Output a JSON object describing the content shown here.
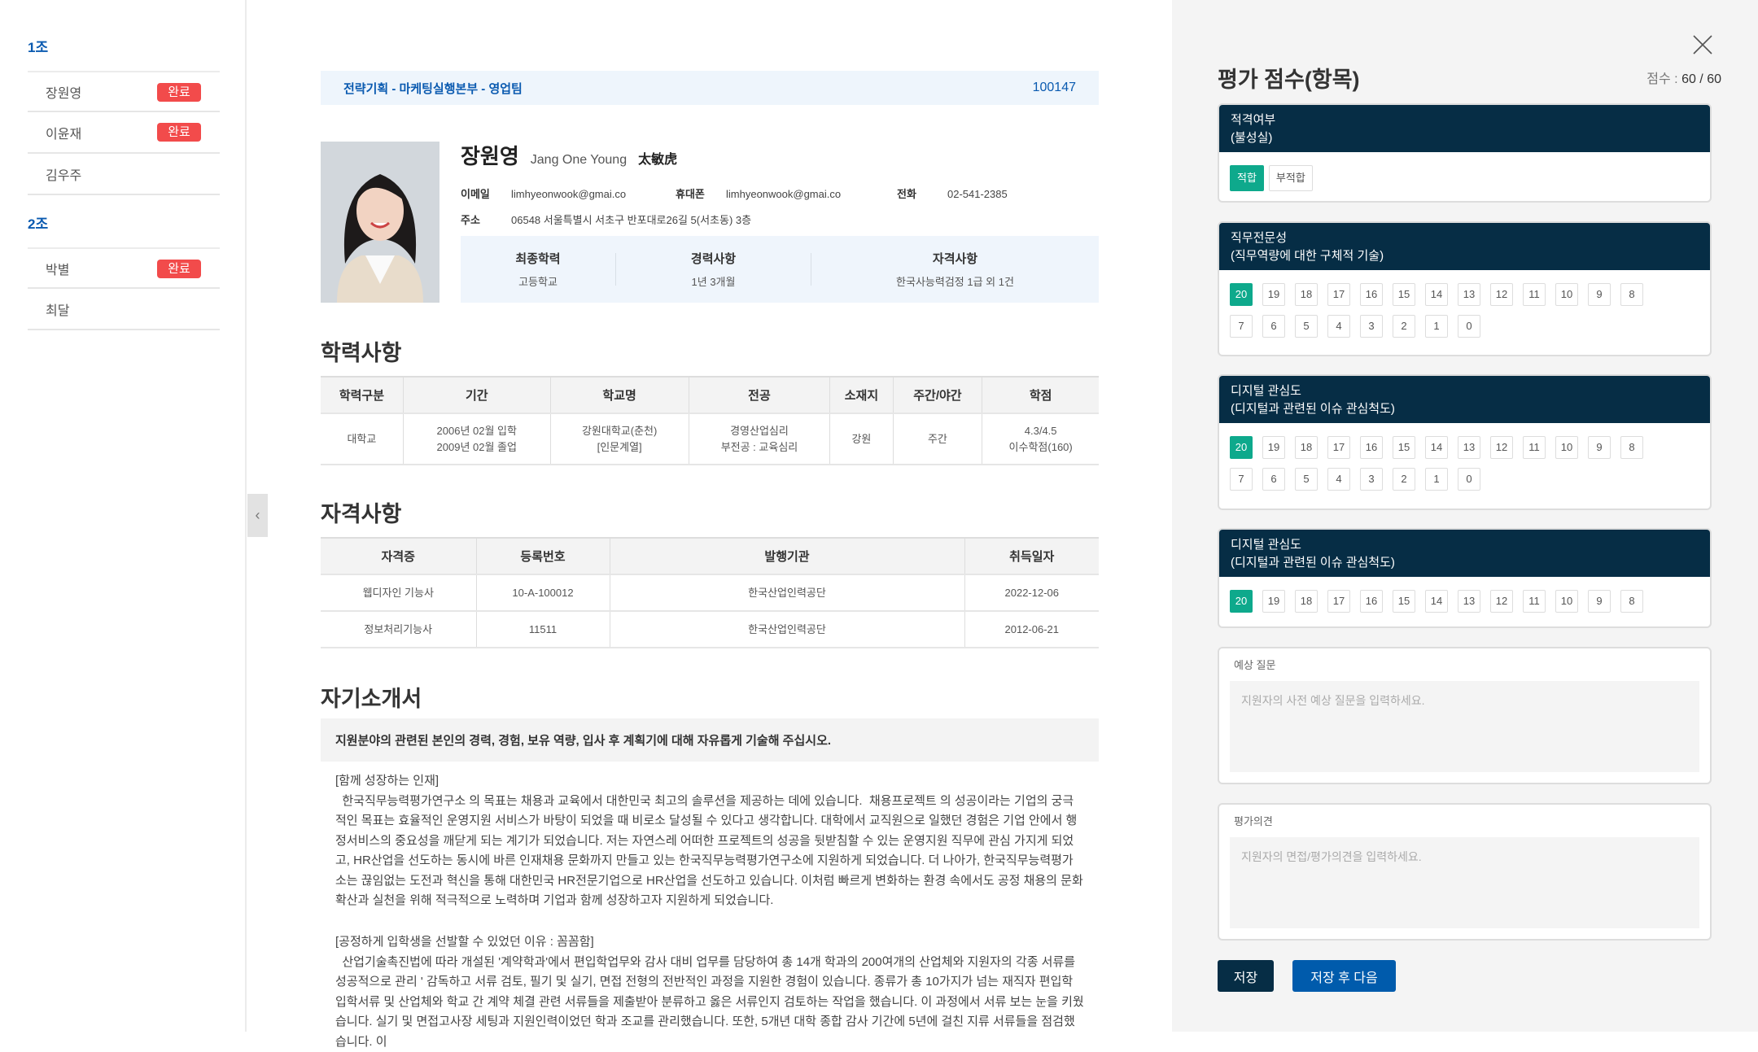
{
  "sidebar": {
    "groups": [
      {
        "label": "1조",
        "members": [
          {
            "name": "장원영",
            "badge": "완료"
          },
          {
            "name": "이윤재",
            "badge": "완료"
          },
          {
            "name": "김우주"
          }
        ]
      },
      {
        "label": "2조",
        "members": [
          {
            "name": "박별",
            "badge": "완료"
          },
          {
            "name": "최달"
          }
        ]
      }
    ]
  },
  "header": {
    "department": "전략기획 - 마케팅실행본부 - 영업팀",
    "applicant_id": "100147"
  },
  "profile": {
    "name_ko": "장원영",
    "name_en": "Jang One Young",
    "name_hanja": "太敏虎",
    "email_label": "이메일",
    "email": "limhyeonwook@gmai.co",
    "mobile_label": "휴대폰",
    "mobile": "limhyeonwook@gmai.co",
    "phone_label": "전화",
    "phone": "02-541-2385",
    "address_label": "주소",
    "address": "06548 서울특별시 서초구 반포대로26길 5(서초동) 3층",
    "summary": [
      {
        "title": "최종학력",
        "value": "고등학교"
      },
      {
        "title": "경력사항",
        "value": "1년 3개월"
      },
      {
        "title": "자격사항",
        "value": "한국사능력검정 1급 외 1건"
      }
    ]
  },
  "education": {
    "title": "학력사항",
    "headers": [
      "학력구분",
      "기간",
      "학교명",
      "전공",
      "소재지",
      "주간/야간",
      "학점"
    ],
    "rows": [
      [
        "대학교",
        "2006년 02월 입학\n2009년 02월 졸업",
        "강원대학교(춘천)\n[인문계열]",
        "경영산업심리\n부전공 : 교육심리",
        "강원",
        "주간",
        "4.3/4.5\n이수학점(160)"
      ]
    ]
  },
  "certificates": {
    "title": "자격사항",
    "headers": [
      "자격증",
      "등록번호",
      "발행기관",
      "취득일자"
    ],
    "rows": [
      [
        "웹디자인 기능사",
        "10-A-100012",
        "한국산업인력공단",
        "2022-12-06"
      ],
      [
        "정보처리기능사",
        "11511",
        "한국산업인력공단",
        "2012-06-21"
      ]
    ]
  },
  "essay": {
    "title": "자기소개서",
    "question": "지원분야의 관련된 본인의 경력, 경험, 보유 역량, 입사 후 계획기에 대해 자유롭게 기술해 주십시오.",
    "p1_title": "[함께 성장하는 인재]",
    "p1_body": "  한국직무능력평가연구소 의 목표는 채용과 교육에서 대한민국 최고의 솔루션을 제공하는 데에 있습니다.  채용프로젝트 의 성공이라는 기업의 궁극적인 목표는 효율적인 운영지원 서비스가 바탕이 되었을 때 비로소 달성될 수 있다고 생각합니다. 대학에서 교직원으로 일했던 경험은 기업 안에서 행정서비스의 중요성을 깨닫게 되는 계기가 되었습니다. 저는 자연스레 어떠한 프로젝트의 성공을 뒷받침할 수 있는 운영지원 직무에 관심 가지게 되었고, HR산업을 선도하는 동시에 바른 인재채용 문화까지 만들고 있는 한국직무능력평가연구소에 지원하게 되었습니다. 더 나아가, 한국직무능력평가소는 끊임없는 도전과 혁신을 통해 대한민국 HR전문기업으로 HR산업을 선도하고 있습니다. 이처럼 빠르게 변화하는 환경 속에서도 공정 채용의 문화확산과 실천을 위해 적극적으로 노력하며 기업과 함께 성장하고자 지원하게 되었습니다.",
    "p2_title": "[공정하게 입학생을 선발할 수 있었던 이유 : 꼼꼼함]",
    "p2_body": "  산업기술촉진법에 따라 개설된 '계약학과'에서 편입학업무와 감사 대비 업무를 담당하여 총 14개 학과의 200여개의 산업체와 지원자의 각종 서류를 성공적으로 관리 ' 감독하고 서류 검토, 필기 및 실기, 면접 전형의 전반적인 과정을 지원한 경험이 있습니다. 종류가 총 10가지가 넘는 재직자 편입학 입학서류 및 산업체와 학교 간 계약 체결 관련 서류들을 제출받아 분류하고 옳은 서류인지 검토하는 작업을 했습니다. 이 과정에서 서류 보는 눈을 키웠습니다. 실기 및 면접고사장 세팅과 지원인력이었던 학과 조교를 관리했습니다. 또한, 5개년 대학 종합 감사 기간에 5년에 걸친 지류 서류들을 점검했습니다. 이"
  },
  "panel": {
    "title": "평가 점수(항목)",
    "score_label": "점수 : ",
    "score": "60 / 60",
    "eligibility": {
      "title": "적격여부",
      "subtitle": "(불성실)",
      "options": [
        "적합",
        "부적합"
      ],
      "selected": "적합"
    },
    "criteria": [
      {
        "title": "직무전문성",
        "subtitle": "(직무역량에 대한 구체적 기술)",
        "options": [
          "20",
          "19",
          "18",
          "17",
          "16",
          "15",
          "14",
          "13",
          "12",
          "11",
          "10",
          "9",
          "8",
          "7",
          "6",
          "5",
          "4",
          "3",
          "2",
          "1",
          "0"
        ],
        "selected": "20"
      },
      {
        "title": "디지털 관심도",
        "subtitle": "(디지털과 관련된 이슈 관심척도)",
        "options": [
          "20",
          "19",
          "18",
          "17",
          "16",
          "15",
          "14",
          "13",
          "12",
          "11",
          "10",
          "9",
          "8",
          "7",
          "6",
          "5",
          "4",
          "3",
          "2",
          "1",
          "0"
        ],
        "selected": "20"
      },
      {
        "title": "디지털 관심도",
        "subtitle": "(디지털과 관련된 이슈 관심척도)",
        "options": [
          "20",
          "19",
          "18",
          "17",
          "16",
          "15",
          "14",
          "13",
          "12",
          "11",
          "10",
          "9",
          "8"
        ],
        "selected": "20"
      }
    ],
    "questions": {
      "label": "예상 질문",
      "placeholder": "지원자의 사전 예상 질문을 입력하세요."
    },
    "opinion": {
      "label": "평가의견",
      "placeholder": "지원자의 면접/평가의견을 입력하세요."
    },
    "save_label": "저장",
    "save_next_label": "저장 후 다음",
    "colors": {
      "navy": "#062d45",
      "selected": "#0ea98c",
      "primary": "#005bac",
      "badge": "#f24b4b"
    }
  }
}
